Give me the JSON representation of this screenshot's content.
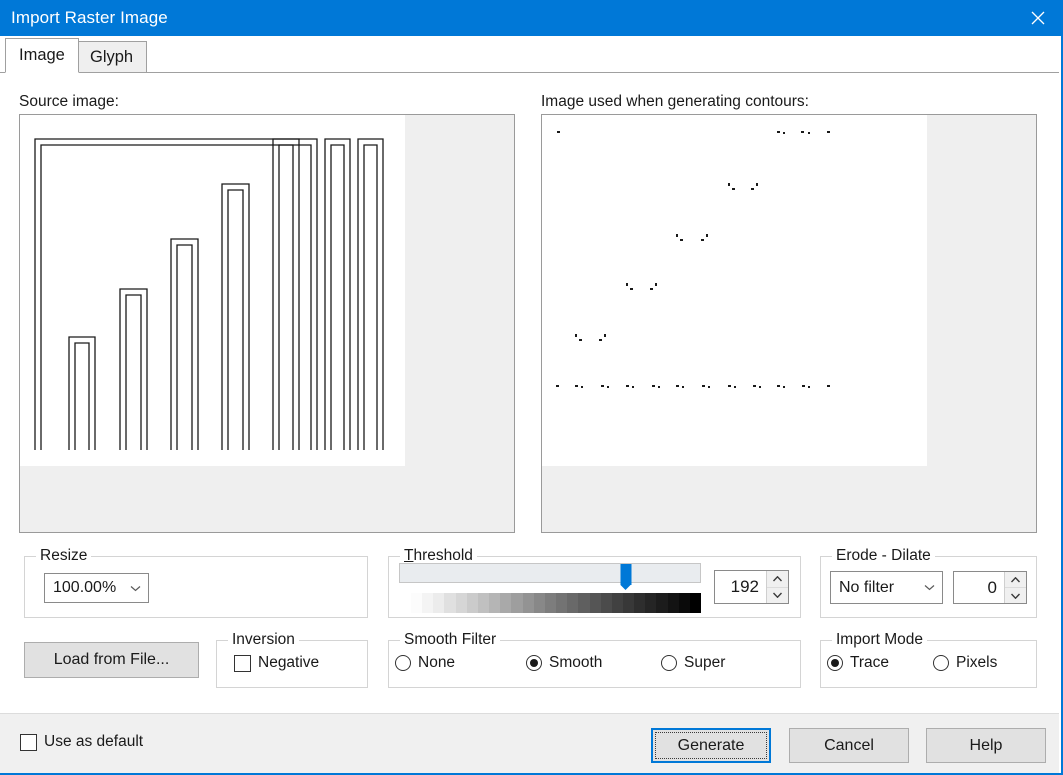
{
  "window": {
    "title": "Import Raster Image",
    "close_icon": "close-icon"
  },
  "tabs": [
    {
      "label": "Image",
      "active": true
    },
    {
      "label": "Glyph",
      "active": false
    }
  ],
  "previews": {
    "source": {
      "label": "Source image:",
      "description": "line-art bar chart outline"
    },
    "contours": {
      "label": "Image used when generating contours:",
      "description": "sparse thresholded corner artifacts"
    }
  },
  "resize": {
    "title": "Resize",
    "value": "100.00%",
    "arrow_icon": "chevron-down-icon"
  },
  "load_button": {
    "label": "Load from File..."
  },
  "inversion": {
    "title": "Inversion",
    "negative_label": "Negative",
    "negative_checked": false
  },
  "threshold": {
    "title": "Threshold",
    "accel": "T",
    "rest": "hreshold",
    "value": "192",
    "slider_percent": 75.3,
    "min": 0,
    "max": 255
  },
  "erode_dilate": {
    "title": "Erode - Dilate",
    "filter_value": "No filter",
    "amount": "0",
    "arrow_icon": "chevron-down-icon"
  },
  "smooth_filter": {
    "title": "Smooth Filter",
    "options": [
      {
        "label": "None",
        "selected": false
      },
      {
        "label": "Smooth",
        "selected": true
      },
      {
        "label": "Super",
        "selected": false
      }
    ]
  },
  "import_mode": {
    "title": "Import Mode",
    "options": [
      {
        "label": "Trace",
        "selected": true
      },
      {
        "label": "Pixels",
        "selected": false
      }
    ]
  },
  "footer": {
    "use_as_default_label": "Use as default",
    "use_as_default_checked": false,
    "generate_label": "Generate",
    "cancel_label": "Cancel",
    "help_label": "Help"
  },
  "colors": {
    "accent": "#0078d7",
    "titlebar": "#0078d7",
    "dialog_bg": "#ffffff",
    "footer_bg": "#f0f0f0",
    "button_face": "#e1e1e1",
    "preview_bg": "#efefef"
  }
}
